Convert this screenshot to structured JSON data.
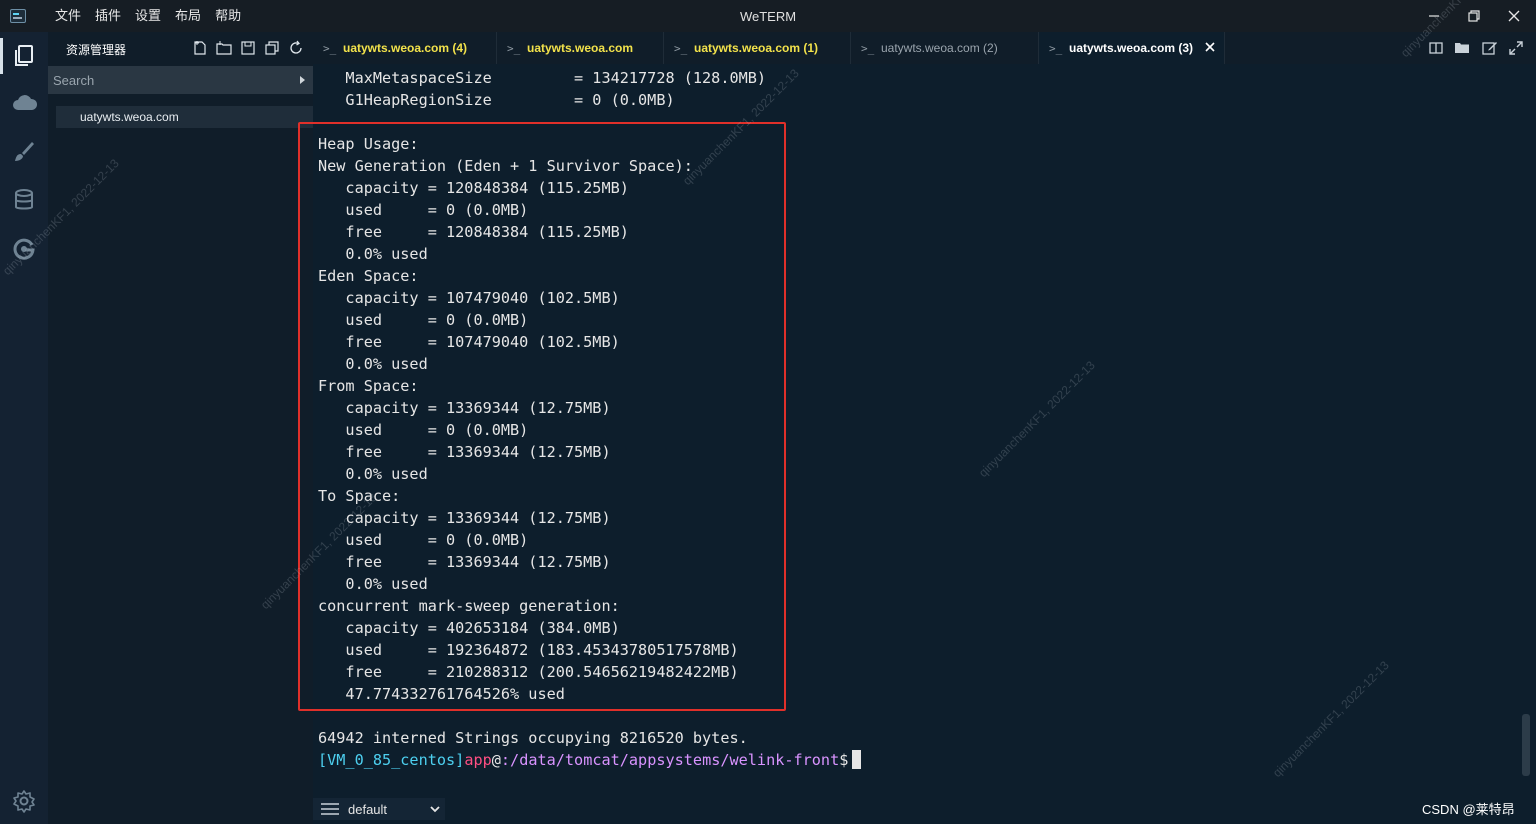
{
  "app": {
    "window_title": "WeTERM",
    "menu": [
      "文件",
      "插件",
      "设置",
      "布局",
      "帮助"
    ]
  },
  "sidebar": {
    "title": "资源管理器",
    "search_placeholder": "Search",
    "hosts": [
      "uatywts.weoa.com"
    ]
  },
  "tabs": [
    {
      "label": "uatywts.weoa.com (4)",
      "color": "#f2e24b",
      "active": false
    },
    {
      "label": "uatywts.weoa.com",
      "color": "#f2e24b",
      "active": false
    },
    {
      "label": "uatywts.weoa.com (1)",
      "color": "#f2e24b",
      "active": false
    },
    {
      "label": "uatywts.weoa.com (2)",
      "color": "#9aa4ad",
      "active": false
    },
    {
      "label": "uatywts.weoa.com (3)",
      "color": "#ffffff",
      "active": true
    }
  ],
  "terminal": {
    "lines": [
      "   MaxMetaspaceSize         = 134217728 (128.0MB)",
      "   G1HeapRegionSize         = 0 (0.0MB)",
      "",
      "Heap Usage:",
      "New Generation (Eden + 1 Survivor Space):",
      "   capacity = 120848384 (115.25MB)",
      "   used     = 0 (0.0MB)",
      "   free     = 120848384 (115.25MB)",
      "   0.0% used",
      "Eden Space:",
      "   capacity = 107479040 (102.5MB)",
      "   used     = 0 (0.0MB)",
      "   free     = 107479040 (102.5MB)",
      "   0.0% used",
      "From Space:",
      "   capacity = 13369344 (12.75MB)",
      "   used     = 0 (0.0MB)",
      "   free     = 13369344 (12.75MB)",
      "   0.0% used",
      "To Space:",
      "   capacity = 13369344 (12.75MB)",
      "   used     = 0 (0.0MB)",
      "   free     = 13369344 (12.75MB)",
      "   0.0% used",
      "concurrent mark-sweep generation:",
      "   capacity = 402653184 (384.0MB)",
      "   used     = 192364872 (183.45343780517578MB)",
      "   free     = 210288312 (200.54656219482422MB)",
      "   47.774332761764526% used",
      "",
      "64942 interned Strings occupying 8216520 bytes."
    ],
    "prompt": {
      "host": "[VM_0_85_centos]",
      "user": "app",
      "at": "@",
      "path": ":/data/tomcat/appsystems/welink-front",
      "symbol": "$"
    }
  },
  "bottom": {
    "profile_select": "default",
    "credit": "CSDN @莱特昂"
  },
  "watermark": "qinyuanchenKF1, 2022-12-13",
  "colors": {
    "highlight_box": "#e0302a",
    "terminal_bg": "#0d1e2c"
  }
}
